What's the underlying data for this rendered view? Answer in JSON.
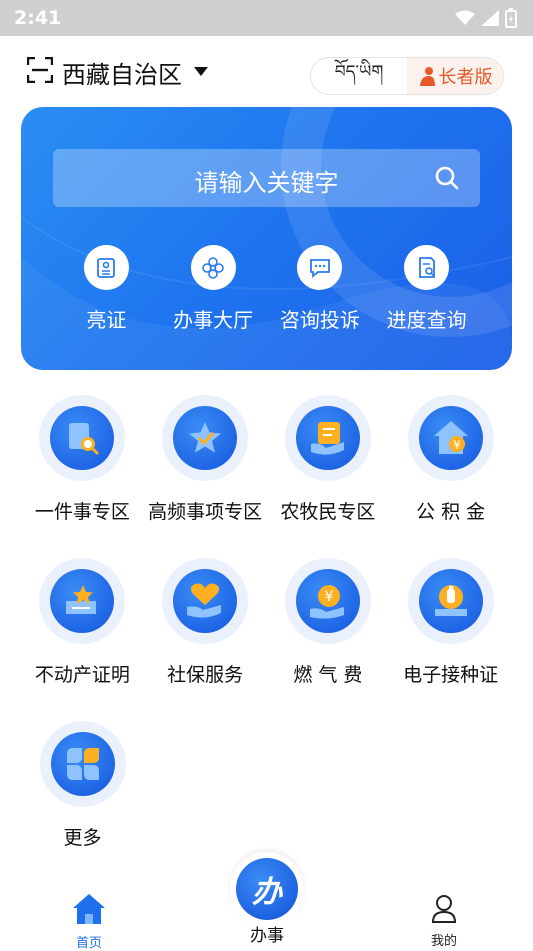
{
  "status": {
    "time": "2:41"
  },
  "header": {
    "region": "西藏自治区",
    "tibetan_label": "བོད་ཡིག",
    "elder_label": "长者版"
  },
  "banner": {
    "search_placeholder": "请输入关键字",
    "items": [
      {
        "label": "亮证",
        "icon": "id-card-icon"
      },
      {
        "label": "办事大厅",
        "icon": "flower-emblem-icon"
      },
      {
        "label": "咨询投诉",
        "icon": "chat-bubble-icon"
      },
      {
        "label": "进度查询",
        "icon": "document-search-icon"
      }
    ]
  },
  "services": [
    {
      "label": "一件事专区",
      "icon": "document-magnifier-icon"
    },
    {
      "label": "高频事项专区",
      "icon": "star-badge-icon"
    },
    {
      "label": "农牧民专区",
      "icon": "hand-document-icon"
    },
    {
      "label": "公 积 金",
      "icon": "house-yen-icon"
    },
    {
      "label": "不动产证明",
      "icon": "star-certificate-icon"
    },
    {
      "label": "社保服务",
      "icon": "hand-heart-icon"
    },
    {
      "label": "燃 气 费",
      "icon": "hand-yen-coin-icon"
    },
    {
      "label": "电子接种证",
      "icon": "vaccine-badge-icon"
    },
    {
      "label": "更多",
      "icon": "four-petal-more-icon"
    }
  ],
  "tabbar": {
    "home": "首页",
    "center": "办事",
    "center_glyph": "办",
    "mine": "我的"
  },
  "colors": {
    "primary": "#1f76ef",
    "elder_accent": "#e8592a",
    "status_bar": "#cfcfcf"
  }
}
